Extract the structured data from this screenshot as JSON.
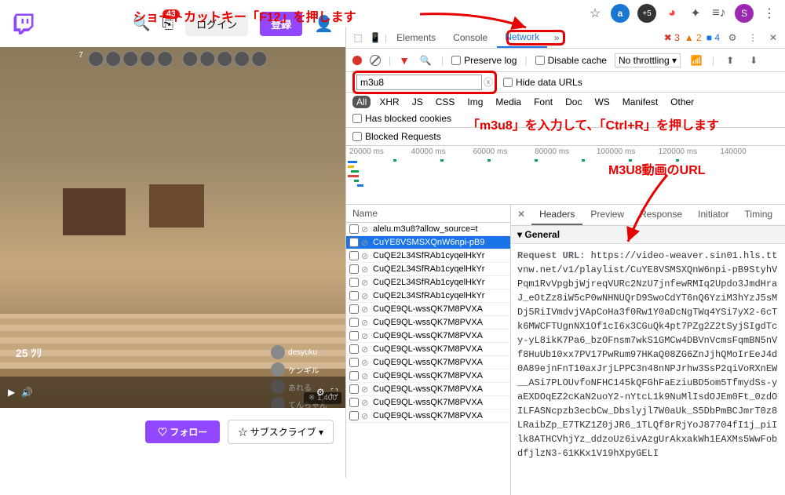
{
  "annotations": {
    "f12": "ショートカットキー「F12」を押します",
    "m3u8": "「m3u8」を入力して、「Ctrl+R」を押します",
    "url": "M3U8動画のURL"
  },
  "browser": {
    "profile": "S"
  },
  "twitch": {
    "badge": "43",
    "login": "ログイン",
    "register": "登録",
    "follow": "♡ フォロー",
    "subscribe": "☆ サブスクライブ ▾",
    "viewers": "※ 1,400",
    "time": "25 ﾂﾘ",
    "chat": [
      "desyuku",
      "ケンギル",
      "あれる",
      "てんちゃん"
    ]
  },
  "devtools": {
    "tabs": {
      "elements": "Elements",
      "console": "Console",
      "network": "Network"
    },
    "status": {
      "err": "✖ 3",
      "warn": "▲ 2",
      "info": "■ 4"
    },
    "toolbar": {
      "preserve": "Preserve log",
      "disable": "Disable cache",
      "throttle": "No throttling"
    },
    "hide_urls": "Hide data URLs",
    "filter_value": "m3u8",
    "filters": [
      "All",
      "XHR",
      "JS",
      "CSS",
      "Img",
      "Media",
      "Font",
      "Doc",
      "WS",
      "Manifest",
      "Other"
    ],
    "has_blocked": "Has blocked cookies",
    "blocked": "Blocked Requests",
    "ticks": [
      "20000 ms",
      "40000 ms",
      "60000 ms",
      "80000 ms",
      "100000 ms",
      "120000 ms",
      "140000"
    ],
    "name_header": "Name",
    "rows": [
      "alelu.m3u8?allow_source=t",
      "CuYE8VSMSXQnW6npi-pB9",
      "CuQE2L34SfRAb1cyqelHkYr",
      "CuQE2L34SfRAb1cyqelHkYr",
      "CuQE2L34SfRAb1cyqelHkYr",
      "CuQE2L34SfRAb1cyqelHkYr",
      "CuQE9QL-wssQK7M8PVXA",
      "CuQE9QL-wssQK7M8PVXA",
      "CuQE9QL-wssQK7M8PVXA",
      "CuQE9QL-wssQK7M8PVXA",
      "CuQE9QL-wssQK7M8PVXA",
      "CuQE9QL-wssQK7M8PVXA",
      "CuQE9QL-wssQK7M8PVXA",
      "CuQE9QL-wssQK7M8PVXA",
      "CuQE9QL-wssQK7M8PVXA"
    ],
    "detail_tabs": {
      "headers": "Headers",
      "preview": "Preview",
      "response": "Response",
      "initiator": "Initiator",
      "timing": "Timing"
    },
    "general": "General",
    "req_url_label": "Request URL:",
    "req_url": "https://video-weaver.sin01.hls.ttvnw.net/v1/playlist/CuYE8VSMSXQnW6npi-pB9StyhVPqm1RvVpgbjWjreqVURc2NzU7jnfewRMIq2Updo3JmdHraJ_eOtZz8iW5cP0wNHNUQrD9SwoCdYT6nQ6YziM3hYzJ5sMDj5RiIVmdvjVApCoHa3f0Rw1Y0aDcNgTWq4YSi7yX2-6cTk6MWCFTUgnNX1Of1cI6x3CGuQk4pt7PZg2Z2tSyjSIgdTcy-yL8ikK7Pa6_bzOFnsm7wkS1GMCw4DBVnVcmsFqmBN5nVf8HuUb10xx7PV17PwRum97HKaQ08ZG6ZnJjhQMoIrEeJ4d0A89ejnFnT10axJrjLPPC3n48nNPJrhw3SsP2qiVoRXnEW__ASi7PLOUvfoNFHC145kQFGhFaEziuBD5om5TfmydSs-yaEXDOqEZ2cKaN2uoY2-nYtcL1k9NuMlIsdOJEm0Ft_0zdOILFASNcpzb3ecbCw_Dbslyjl7W0aUk_S5DbPmBCJmrT0z8LRaibZp_E7TKZ1Z0jJR6_1TLQf8rRjYoJ87704fI1j_piIlk8ATHCVhjYz_ddzoUz6ivAzgUrAkxakWh1EAXMs5WwFobdfjlzN3-61KKx1V19hXpyGELI"
  }
}
